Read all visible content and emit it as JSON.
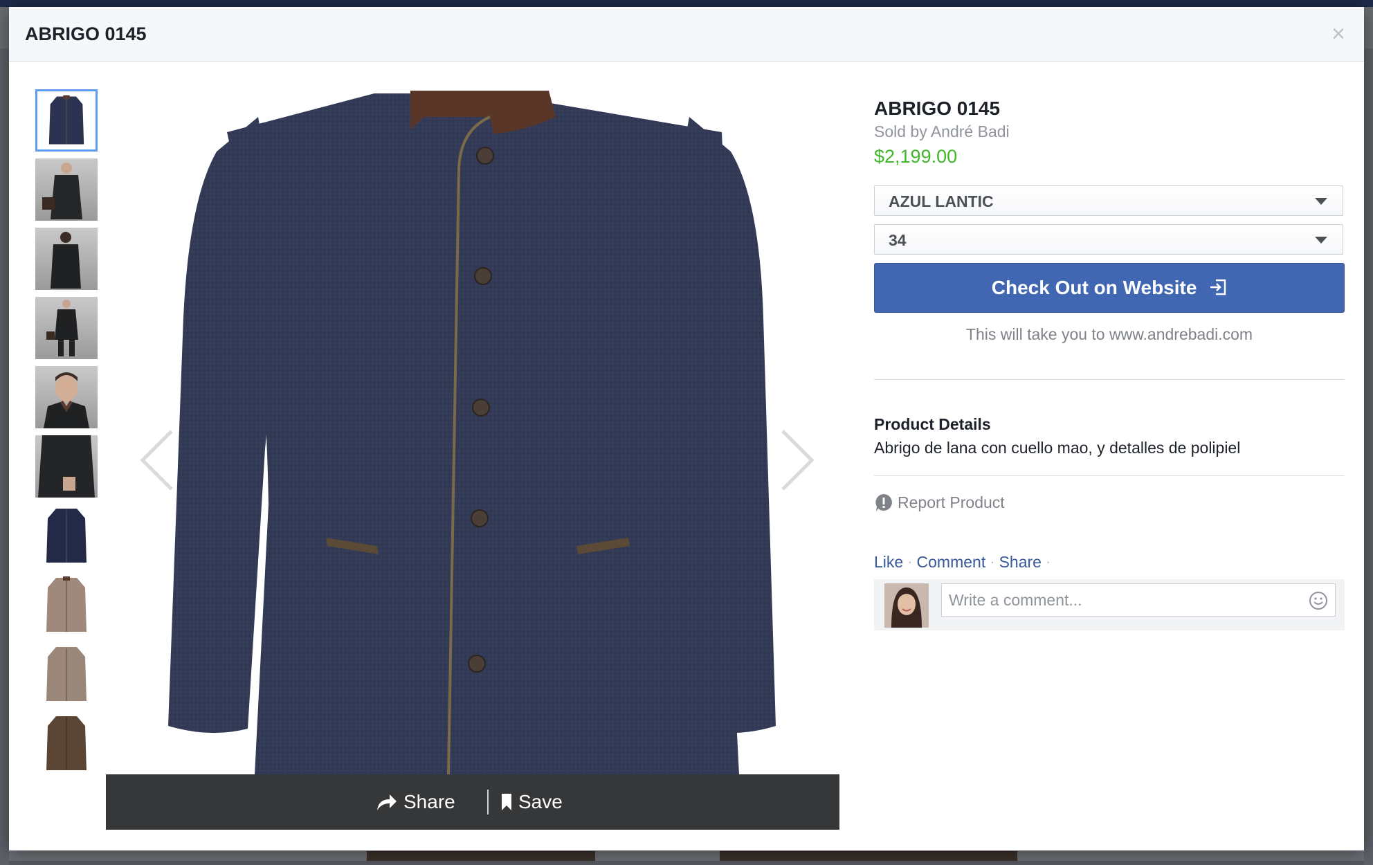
{
  "modal": {
    "title": "ABRIGO 0145",
    "close_glyph": "×"
  },
  "thumbnails": [
    {
      "icon": "navy-coat-front",
      "active": true
    },
    {
      "icon": "model-coat-bag",
      "active": false
    },
    {
      "icon": "model-coat-back",
      "active": false
    },
    {
      "icon": "model-coat-full",
      "active": false
    },
    {
      "icon": "model-portrait",
      "active": false
    },
    {
      "icon": "coat-detail",
      "active": false
    },
    {
      "icon": "navy-coat-small",
      "active": false
    },
    {
      "icon": "beige-coat",
      "active": false
    },
    {
      "icon": "beige-coat-alt",
      "active": false
    },
    {
      "icon": "brown-coat",
      "active": false
    }
  ],
  "share_bar": {
    "share_label": "Share",
    "save_label": "Save"
  },
  "product": {
    "title": "ABRIGO 0145",
    "seller": "Sold by André Badi",
    "price": "$2,199.00",
    "color_option": "AZUL LANTIC",
    "size_option": "34",
    "checkout_label": "Check Out on Website",
    "redirect_note": "This will take you to www.andrebadi.com",
    "details_heading": "Product Details",
    "details_text": "Abrigo de lana con cuello mao, y detalles de polipiel",
    "report_label": "Report Product"
  },
  "ufi": {
    "like": "Like",
    "comment": "Comment",
    "share": "Share",
    "separator": "·",
    "comment_placeholder": "Write a comment..."
  },
  "colors": {
    "accent": "#4267b2",
    "price": "#42b72a",
    "link": "#385898",
    "coat": "#323a56"
  }
}
